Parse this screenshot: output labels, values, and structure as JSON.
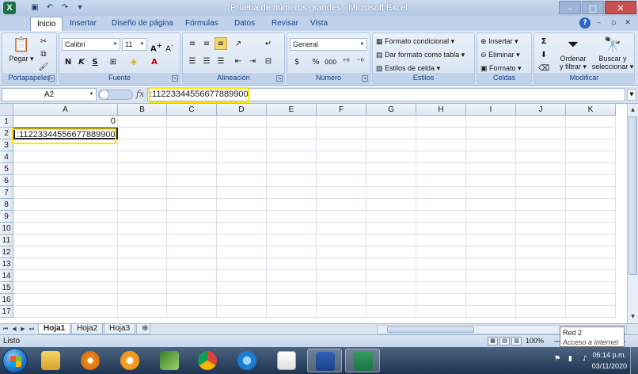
{
  "window": {
    "title": "Prueba de números grandes - Microsoft Excel",
    "app_icon": "X",
    "quick_access": [
      "save-icon",
      "undo-icon",
      "redo-icon",
      "customize-icon"
    ]
  },
  "ribbon_tabs": [
    "Inicio",
    "Insertar",
    "Diseño de página",
    "Fórmulas",
    "Datos",
    "Revisar",
    "Vista"
  ],
  "ribbon": {
    "portapapeles": {
      "label": "Portapapeles",
      "paste": "Pegar"
    },
    "fuente": {
      "label": "Fuente",
      "font_name": "Calibri",
      "font_size": "11",
      "bold": "N",
      "italic": "K",
      "underline": "S"
    },
    "alineacion": {
      "label": "Alineación"
    },
    "numero": {
      "label": "Número",
      "format": "General",
      "currency": "$",
      "percent": "%",
      "thousands": "000"
    },
    "estilos": {
      "label": "Estilos",
      "conditional": "Formato condicional",
      "table": "Dar formato como tabla",
      "cell_styles": "Estilos de celda"
    },
    "celdas": {
      "label": "Celdas",
      "insert": "Insertar",
      "delete": "Eliminar",
      "format": "Formato"
    },
    "modificar": {
      "label": "Modificar",
      "sort_line1": "Ordenar",
      "sort_line2": "y filtrar",
      "find_line1": "Buscar y",
      "find_line2": "seleccionar"
    }
  },
  "formula_bar": {
    "name_box": "A2",
    "fx": "fx",
    "content": ":11223344556677889900"
  },
  "columns": [
    "A",
    "B",
    "C",
    "D",
    "E",
    "F",
    "G",
    "H",
    "I",
    "J",
    "K"
  ],
  "rows": [
    "1",
    "2",
    "3",
    "4",
    "5",
    "6",
    "7",
    "8",
    "9",
    "10",
    "11",
    "12",
    "13",
    "14",
    "15",
    "16",
    "17"
  ],
  "cells": {
    "A1": "0",
    "A2": ":11223344556677889900"
  },
  "sheets": [
    "Hoja1",
    "Hoja2",
    "Hoja3"
  ],
  "status": {
    "text": "Listo",
    "zoom": "100%"
  },
  "tooltip": {
    "line1": "Red  2",
    "line2": "Acceso a Internet"
  },
  "taskbar": {
    "time": "06:14 p.m.",
    "date": "03/11/2020"
  },
  "colors": {
    "highlight_box": "#ffe600",
    "excel_green": "#1e7145"
  }
}
